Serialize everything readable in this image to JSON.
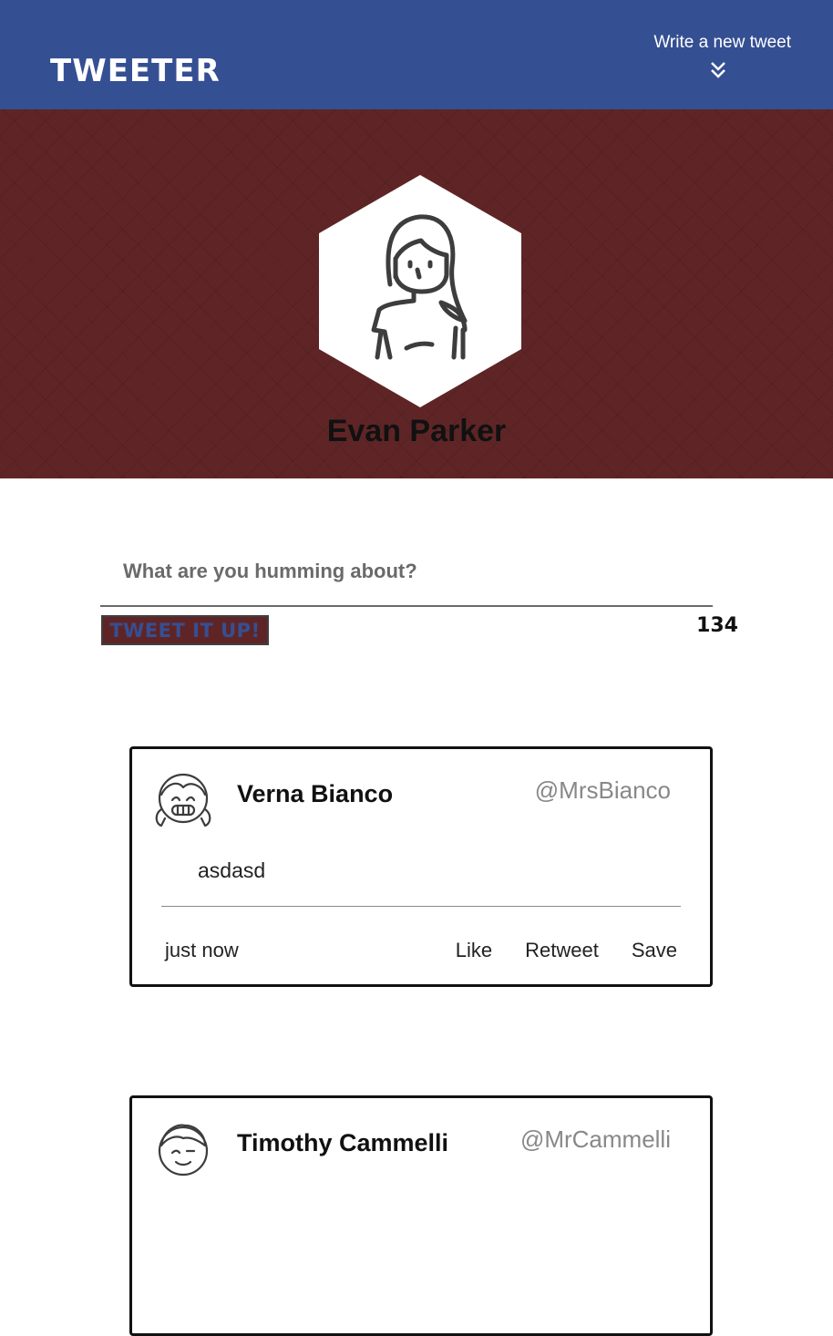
{
  "nav": {
    "brand": "TWEETER",
    "compose_link": "Write a new tweet",
    "compose_icon": "double-chevron-down-icon"
  },
  "profile": {
    "name": "Evan Parker",
    "avatar_icon": "woman-avatar-icon",
    "banner_color": "#5f2526"
  },
  "compose": {
    "placeholder": "What are you humming about?",
    "value": "",
    "button_label": "TWEET IT UP!",
    "char_counter": "134"
  },
  "tweets": [
    {
      "author": "Verna Bianco",
      "handle": "@MrsBianco",
      "avatar_icon": "girl-pigtails-avatar-icon",
      "content": "asdasd",
      "timestamp": "just now",
      "actions": [
        "Like",
        "Retweet",
        "Save"
      ]
    },
    {
      "author": "Timothy Cammelli",
      "handle": "@MrCammelli",
      "avatar_icon": "boy-winking-avatar-icon",
      "content": "",
      "timestamp": "",
      "actions": []
    }
  ],
  "colors": {
    "nav_bg": "#354f93",
    "accent": "#5f2526"
  }
}
